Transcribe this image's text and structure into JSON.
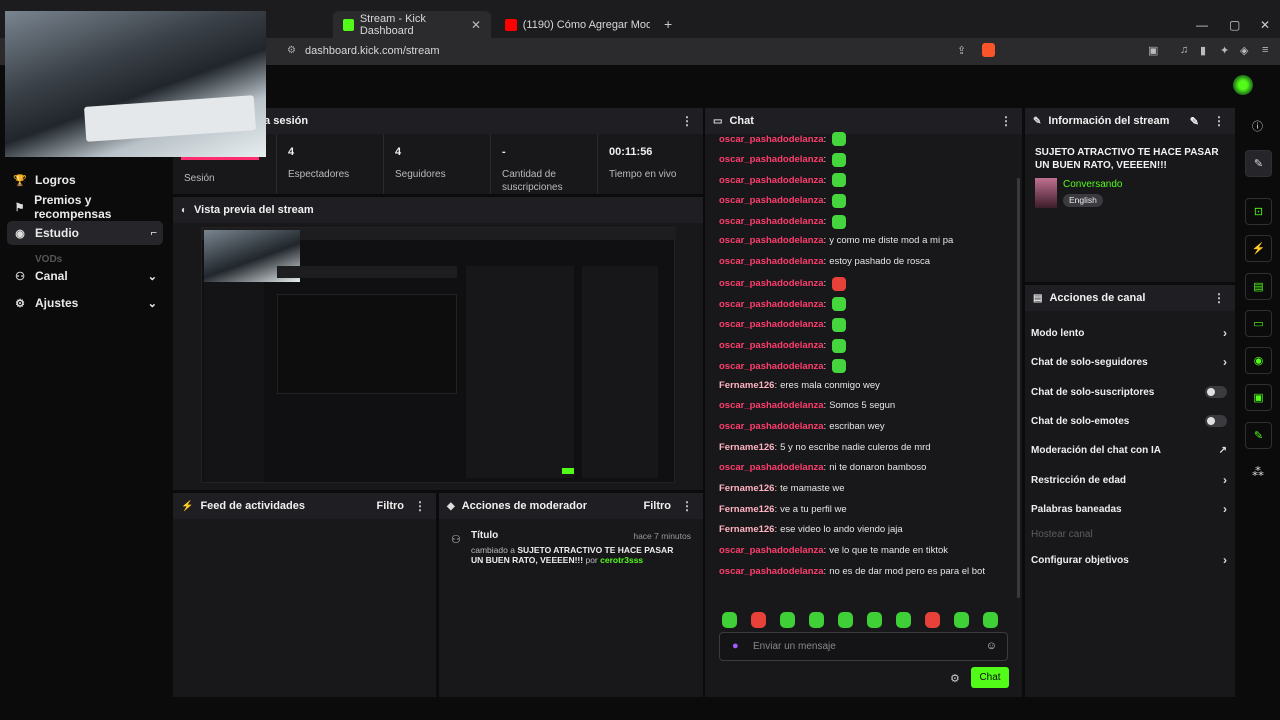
{
  "browser": {
    "tabs": [
      {
        "label": "Stream - Kick Dashboard",
        "active": true
      },
      {
        "label": "(1190) Cómo Agregar Moderadores",
        "active": false
      }
    ],
    "url": "dashboard.kick.com/stream"
  },
  "sidebar": {
    "items": [
      {
        "label": "Logros",
        "icon": "trophy-icon"
      },
      {
        "label": "Premios y recompensas",
        "icon": "gift-icon"
      },
      {
        "label": "Estudio",
        "icon": "studio-icon",
        "active": true
      },
      {
        "label": "VODs",
        "icon": ""
      },
      {
        "label": "Canal",
        "icon": "channel-icon"
      },
      {
        "label": "Ajustes",
        "icon": "gear-icon"
      }
    ]
  },
  "session": {
    "title": "la sesión",
    "stats": [
      {
        "value": "",
        "label": "Sesión"
      },
      {
        "value": "4",
        "label": "Espectadores"
      },
      {
        "value": "4",
        "label": "Seguidores"
      },
      {
        "value": "-",
        "label": "Cantidad de suscripciones"
      },
      {
        "value": "00:11:56",
        "label": "Tiempo en vivo"
      }
    ]
  },
  "preview": {
    "title": "Vista previa del stream"
  },
  "activity_feed": {
    "title": "Feed de actividades",
    "filter": "Filtro"
  },
  "mod_actions": {
    "title": "Acciones de moderador",
    "filter": "Filtro",
    "entry": {
      "type": "Título",
      "time": "hace 7 minutos",
      "prefix": "cambiado a",
      "text": "SUJETO ATRACTIVO TE HACE PASAR UN BUEN RATO, VEEEEN!!!",
      "by": "por",
      "user": "cerotr3sss"
    }
  },
  "chat": {
    "title": "Chat",
    "messages": [
      {
        "user": "oscar_pashadodelanza",
        "text": "",
        "emote": true
      },
      {
        "user": "oscar_pashadodelanza",
        "text": "",
        "emote": true
      },
      {
        "user": "oscar_pashadodelanza",
        "text": "",
        "emote": true
      },
      {
        "user": "oscar_pashadodelanza",
        "text": "",
        "emote": true
      },
      {
        "user": "oscar_pashadodelanza",
        "text": "",
        "emote": true
      },
      {
        "user": "oscar_pashadodelanza",
        "text": "y como me diste mod a mi pa",
        "emote": false
      },
      {
        "user": "oscar_pashadodelanza",
        "text": "estoy pashado de rosca",
        "emote": false
      },
      {
        "user": "oscar_pashadodelanza",
        "text": "",
        "emote": true
      },
      {
        "user": "oscar_pashadodelanza",
        "text": "",
        "emote": true
      },
      {
        "user": "oscar_pashadodelanza",
        "text": "",
        "emote": true
      },
      {
        "user": "oscar_pashadodelanza",
        "text": "",
        "emote": true
      },
      {
        "user": "oscar_pashadodelanza",
        "text": "",
        "emote": true
      },
      {
        "user": "Fername126",
        "text": "eres mala conmigo wey",
        "emote": false
      },
      {
        "user": "oscar_pashadodelanza",
        "text": "Somos 5 segun",
        "emote": false
      },
      {
        "user": "oscar_pashadodelanza",
        "text": "escriban wey",
        "emote": false
      },
      {
        "user": "Fername126",
        "text": "5 y no escribe nadie culeros de mrd",
        "emote": false
      },
      {
        "user": "oscar_pashadodelanza",
        "text": "ni te donaron bamboso",
        "emote": false
      },
      {
        "user": "Fername126",
        "text": "te mamaste we",
        "emote": false
      },
      {
        "user": "Fername126",
        "text": "ve a tu perfil we",
        "emote": false
      },
      {
        "user": "Fername126",
        "text": "ese video lo ando viendo jaja",
        "emote": false
      },
      {
        "user": "oscar_pashadodelanza",
        "text": "ve lo que te mande en tiktok",
        "emote": false
      },
      {
        "user": "oscar_pashadodelanza",
        "text": "no es de dar mod pero es para el bot",
        "emote": false
      }
    ],
    "input_placeholder": "Enviar un mensaje",
    "send_label": "Chat"
  },
  "stream_info": {
    "title": "Información del stream",
    "stream_title": "SUJETO ATRACTIVO TE HACE PASAR UN BUEN RATO, VEEEEN!!!",
    "category": "Conversando",
    "language": "English"
  },
  "channel_actions": {
    "title": "Acciones de canal",
    "items": [
      {
        "label": "Modo lento",
        "control": "chevron"
      },
      {
        "label": "Chat de solo-seguidores",
        "control": "chevron"
      },
      {
        "label": "Chat de solo-suscriptores",
        "control": "toggle"
      },
      {
        "label": "Chat de solo-emotes",
        "control": "toggle"
      },
      {
        "label": "Moderación del chat con IA",
        "control": "external"
      },
      {
        "label": "Restricción de edad",
        "control": "chevron"
      },
      {
        "label": "Palabras baneadas",
        "control": "chevron"
      },
      {
        "label": "Hostear canal",
        "control": "none",
        "disabled": true
      },
      {
        "label": "Configurar objetivos",
        "control": "chevron"
      }
    ]
  },
  "colors": {
    "accent": "#53fc18",
    "username_primary": "#ff3d6e",
    "username_secondary": "#ffb3c0"
  }
}
